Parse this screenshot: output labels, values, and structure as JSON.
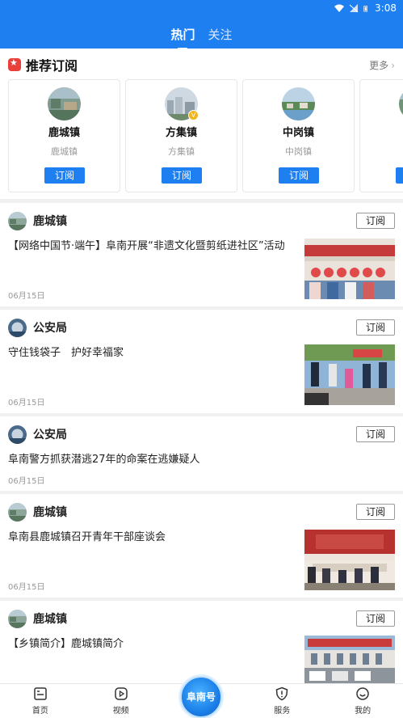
{
  "status": {
    "time": "3:08"
  },
  "header": {
    "tabs": [
      {
        "label": "热门"
      },
      {
        "label": "关注"
      }
    ]
  },
  "recommend": {
    "title": "推荐订阅",
    "more_label": "更多",
    "cards": [
      {
        "name": "鹿城镇",
        "sub": "鹿城镇",
        "button": "订阅"
      },
      {
        "name": "方集镇",
        "sub": "方集镇",
        "button": "订阅",
        "badge": "V"
      },
      {
        "name": "中岗镇",
        "sub": "中岗镇",
        "button": "订阅"
      }
    ]
  },
  "feed": [
    {
      "source": "鹿城镇",
      "subscribe": "订阅",
      "title": "【网络中国节·端午】阜南开展“非遗文化暨剪纸进社区”活动",
      "date": "06月15日"
    },
    {
      "source": "公安局",
      "subscribe": "订阅",
      "title": "守住钱袋子　护好幸福家",
      "date": "06月15日"
    },
    {
      "source": "公安局",
      "subscribe": "订阅",
      "title": "阜南警方抓获潜逃27年的命案在逃嫌疑人",
      "date": "06月15日"
    },
    {
      "source": "鹿城镇",
      "subscribe": "订阅",
      "title": "阜南县鹿城镇召开青年干部座谈会",
      "date": "06月15日"
    },
    {
      "source": "鹿城镇",
      "subscribe": "订阅",
      "title": "【乡镇简介】鹿城镇简介"
    }
  ],
  "bottom_nav": {
    "items": [
      {
        "label": "首页",
        "icon": "home-icon"
      },
      {
        "label": "视频",
        "icon": "video-icon"
      },
      {
        "label": "服务",
        "icon": "service-icon"
      },
      {
        "label": "我的",
        "icon": "profile-icon"
      }
    ],
    "center_label": "阜南号"
  }
}
